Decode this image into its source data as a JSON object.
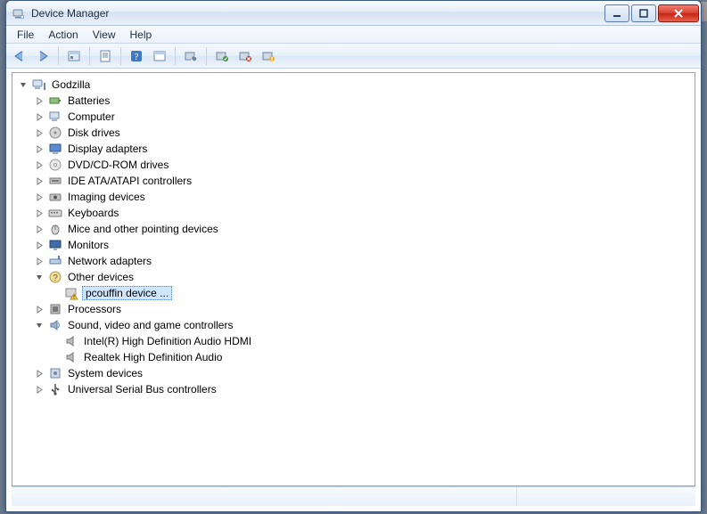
{
  "window": {
    "title": "Device Manager"
  },
  "menubar": [
    "File",
    "Action",
    "View",
    "Help"
  ],
  "toolbar": [
    {
      "name": "back-icon"
    },
    {
      "name": "forward-icon"
    },
    {
      "sep": true
    },
    {
      "name": "show-hidden-icon"
    },
    {
      "sep": true
    },
    {
      "name": "properties-page-icon"
    },
    {
      "sep": true
    },
    {
      "name": "help-icon"
    },
    {
      "name": "window-icon"
    },
    {
      "sep": true
    },
    {
      "name": "update-driver-icon"
    },
    {
      "sep": true
    },
    {
      "name": "scan-hardware-icon"
    },
    {
      "name": "uninstall-icon"
    },
    {
      "name": "disable-icon"
    }
  ],
  "tree": {
    "root": {
      "label": "Godzilla",
      "icon": "computer-root-icon",
      "expanded": true,
      "children": [
        {
          "label": "Batteries",
          "icon": "battery-icon",
          "expandable": true
        },
        {
          "label": "Computer",
          "icon": "computer-icon",
          "expandable": true
        },
        {
          "label": "Disk drives",
          "icon": "disk-icon",
          "expandable": true
        },
        {
          "label": "Display adapters",
          "icon": "display-icon",
          "expandable": true
        },
        {
          "label": "DVD/CD-ROM drives",
          "icon": "optical-icon",
          "expandable": true
        },
        {
          "label": "IDE ATA/ATAPI controllers",
          "icon": "ide-icon",
          "expandable": true
        },
        {
          "label": "Imaging devices",
          "icon": "imaging-icon",
          "expandable": true
        },
        {
          "label": "Keyboards",
          "icon": "keyboard-icon",
          "expandable": true
        },
        {
          "label": "Mice and other pointing devices",
          "icon": "mouse-icon",
          "expandable": true
        },
        {
          "label": "Monitors",
          "icon": "monitor-icon",
          "expandable": true
        },
        {
          "label": "Network adapters",
          "icon": "network-icon",
          "expandable": true
        },
        {
          "label": "Other devices",
          "icon": "other-icon",
          "expandable": true,
          "expanded": true,
          "children": [
            {
              "label": "pcouffin device ...",
              "icon": "warning-device-icon",
              "selected": true
            }
          ]
        },
        {
          "label": "Processors",
          "icon": "cpu-icon",
          "expandable": true
        },
        {
          "label": "Sound, video and game controllers",
          "icon": "sound-icon",
          "expandable": true,
          "expanded": true,
          "children": [
            {
              "label": "Intel(R) High Definition Audio HDMI",
              "icon": "speaker-icon"
            },
            {
              "label": "Realtek High Definition Audio",
              "icon": "speaker-icon"
            }
          ]
        },
        {
          "label": "System devices",
          "icon": "system-icon",
          "expandable": true
        },
        {
          "label": "Universal Serial Bus controllers",
          "icon": "usb-icon",
          "expandable": true
        }
      ]
    }
  }
}
